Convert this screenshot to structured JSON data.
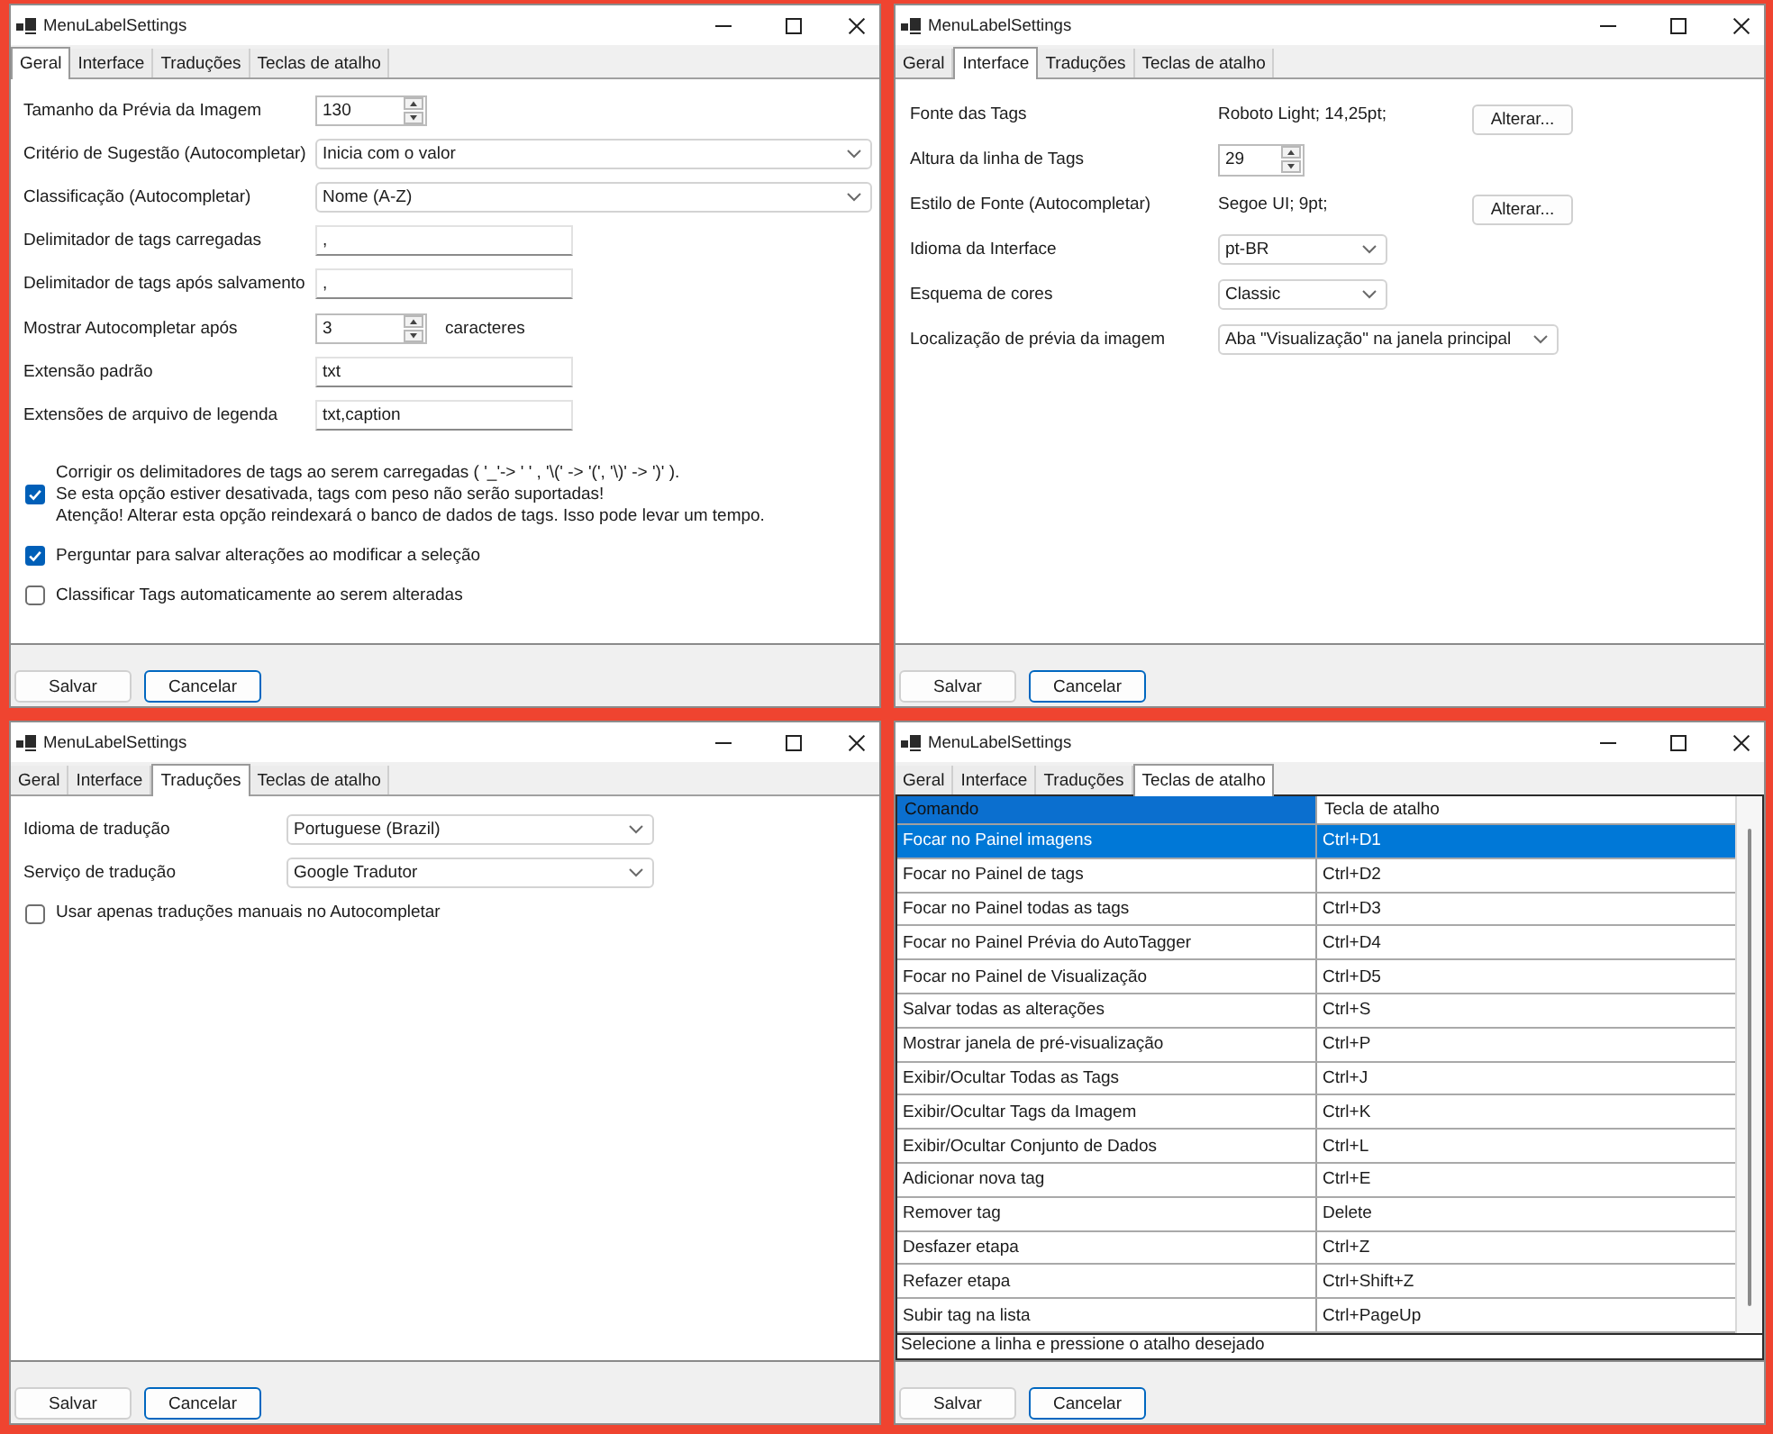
{
  "windows": [
    {
      "title": "MenuLabelSettings",
      "tabs": [
        {
          "label": "Geral",
          "selected": true
        },
        {
          "label": "Interface",
          "selected": false
        },
        {
          "label": "Traduções",
          "selected": false
        },
        {
          "label": "Teclas de atalho",
          "selected": false
        }
      ],
      "panel": {
        "kind": "general",
        "fields": [
          {
            "label": "Tamanho da Prévia da Imagem",
            "kind": "spin",
            "value": "130"
          },
          {
            "label": "Critério de Sugestão (Autocompletar)",
            "kind": "dropdown",
            "value": "Inicia com o valor"
          },
          {
            "label": "Classificação (Autocompletar)",
            "kind": "dropdown",
            "value": "Nome (A-Z)"
          },
          {
            "label": "Delimitador de tags carregadas",
            "kind": "text",
            "value": ","
          },
          {
            "label": "Delimitador de tags após salvamento",
            "kind": "text",
            "value": ","
          },
          {
            "label": "Mostrar Autocompletar após",
            "kind": "spin",
            "value": "3",
            "suffix": "caracteres"
          },
          {
            "label": "Extensão padrão",
            "kind": "text",
            "value": "txt"
          },
          {
            "label": "Extensões de arquivo de legenda",
            "kind": "text",
            "value": "txt,caption"
          }
        ],
        "checkboxes": [
          {
            "label": "Corrigir os delimitadores de tags ao serem carregadas ( '_'-> ' ' , '\\(' -> '(', '\\)' -> ')' ).\nSe esta opção estiver desativada, tags com peso não serão suportadas!\nAtenção! Alterar esta opção reindexará o banco de dados de tags. Isso pode levar um tempo.",
            "checked": true
          },
          {
            "label": "Perguntar para salvar alterações ao modificar a seleção",
            "checked": true
          },
          {
            "label": "Classificar Tags automaticamente ao serem alteradas",
            "checked": false
          }
        ]
      },
      "buttons": [
        {
          "label": "Salvar",
          "default": false
        },
        {
          "label": "Cancelar",
          "default": true
        }
      ]
    },
    {
      "title": "MenuLabelSettings",
      "tabs": [
        {
          "label": "Geral",
          "selected": false
        },
        {
          "label": "Interface",
          "selected": true
        },
        {
          "label": "Traduções",
          "selected": false
        },
        {
          "label": "Teclas de atalho",
          "selected": false
        }
      ],
      "panel": {
        "kind": "interface",
        "fields": [
          {
            "label": "Fonte das Tags",
            "kind": "font",
            "value": "Roboto Light; 14,25pt;",
            "button": "Alterar..."
          },
          {
            "label": "Altura da linha de Tags",
            "kind": "spin",
            "value": "29"
          },
          {
            "label": "Estilo de Fonte (Autocompletar)",
            "kind": "font",
            "value": "Segoe UI; 9pt;",
            "button": "Alterar..."
          },
          {
            "label": "Idioma da Interface",
            "kind": "dropdown",
            "value": "pt-BR"
          },
          {
            "label": "Esquema de cores",
            "kind": "dropdown",
            "value": "Classic"
          },
          {
            "label": "Localização de prévia da imagem",
            "kind": "dropdown",
            "value": "Aba \"Visualização\" na janela principal"
          }
        ]
      },
      "buttons": [
        {
          "label": "Salvar",
          "default": false
        },
        {
          "label": "Cancelar",
          "default": true
        }
      ]
    },
    {
      "title": "MenuLabelSettings",
      "tabs": [
        {
          "label": "Geral",
          "selected": false
        },
        {
          "label": "Interface",
          "selected": false
        },
        {
          "label": "Traduções",
          "selected": true
        },
        {
          "label": "Teclas de atalho",
          "selected": false
        }
      ],
      "panel": {
        "kind": "translations",
        "fields": [
          {
            "label": "Idioma de tradução",
            "kind": "dropdown",
            "value": "Portuguese (Brazil)"
          },
          {
            "label": "Serviço de tradução",
            "kind": "dropdown",
            "value": "Google Tradutor"
          }
        ],
        "checkboxes": [
          {
            "label": "Usar apenas traduções manuais no Autocompletar",
            "checked": false
          }
        ]
      },
      "buttons": [
        {
          "label": "Salvar",
          "default": false
        },
        {
          "label": "Cancelar",
          "default": true
        }
      ]
    },
    {
      "title": "MenuLabelSettings",
      "tabs": [
        {
          "label": "Geral",
          "selected": false
        },
        {
          "label": "Interface",
          "selected": false
        },
        {
          "label": "Traduções",
          "selected": false
        },
        {
          "label": "Teclas de atalho",
          "selected": true
        }
      ],
      "panel": {
        "kind": "shortcuts",
        "columns": [
          {
            "label": "Comando",
            "highlighted": true
          },
          {
            "label": "Tecla de atalho",
            "highlighted": false
          }
        ],
        "rows": [
          {
            "cells": [
              "Focar no Painel imagens",
              "Ctrl+D1"
            ],
            "selected": true
          },
          {
            "cells": [
              "Focar no Painel de tags",
              "Ctrl+D2"
            ],
            "selected": false
          },
          {
            "cells": [
              "Focar no Painel todas as tags",
              "Ctrl+D3"
            ],
            "selected": false
          },
          {
            "cells": [
              "Focar no Painel Prévia do AutoTagger",
              "Ctrl+D4"
            ],
            "selected": false
          },
          {
            "cells": [
              "Focar no Painel de Visualização",
              "Ctrl+D5"
            ],
            "selected": false
          },
          {
            "cells": [
              "Salvar todas as alterações",
              "Ctrl+S"
            ],
            "selected": false
          },
          {
            "cells": [
              "Mostrar janela de pré-visualização",
              "Ctrl+P"
            ],
            "selected": false
          },
          {
            "cells": [
              "Exibir/Ocultar Todas as Tags",
              "Ctrl+J"
            ],
            "selected": false
          },
          {
            "cells": [
              "Exibir/Ocultar Tags da Imagem",
              "Ctrl+K"
            ],
            "selected": false
          },
          {
            "cells": [
              "Exibir/Ocultar Conjunto de Dados",
              "Ctrl+L"
            ],
            "selected": false
          },
          {
            "cells": [
              "Adicionar nova tag",
              "Ctrl+E"
            ],
            "selected": false
          },
          {
            "cells": [
              "Remover tag",
              "Delete"
            ],
            "selected": false
          },
          {
            "cells": [
              "Desfazer etapa",
              "Ctrl+Z"
            ],
            "selected": false
          },
          {
            "cells": [
              "Refazer etapa",
              "Ctrl+Shift+Z"
            ],
            "selected": false
          },
          {
            "cells": [
              "Subir tag na lista",
              "Ctrl+PageUp"
            ],
            "selected": false
          }
        ],
        "status": "Selecione a linha e pressione o atalho desejado"
      },
      "buttons": [
        {
          "label": "Salvar",
          "default": false
        },
        {
          "label": "Cancelar",
          "default": true
        }
      ]
    }
  ]
}
